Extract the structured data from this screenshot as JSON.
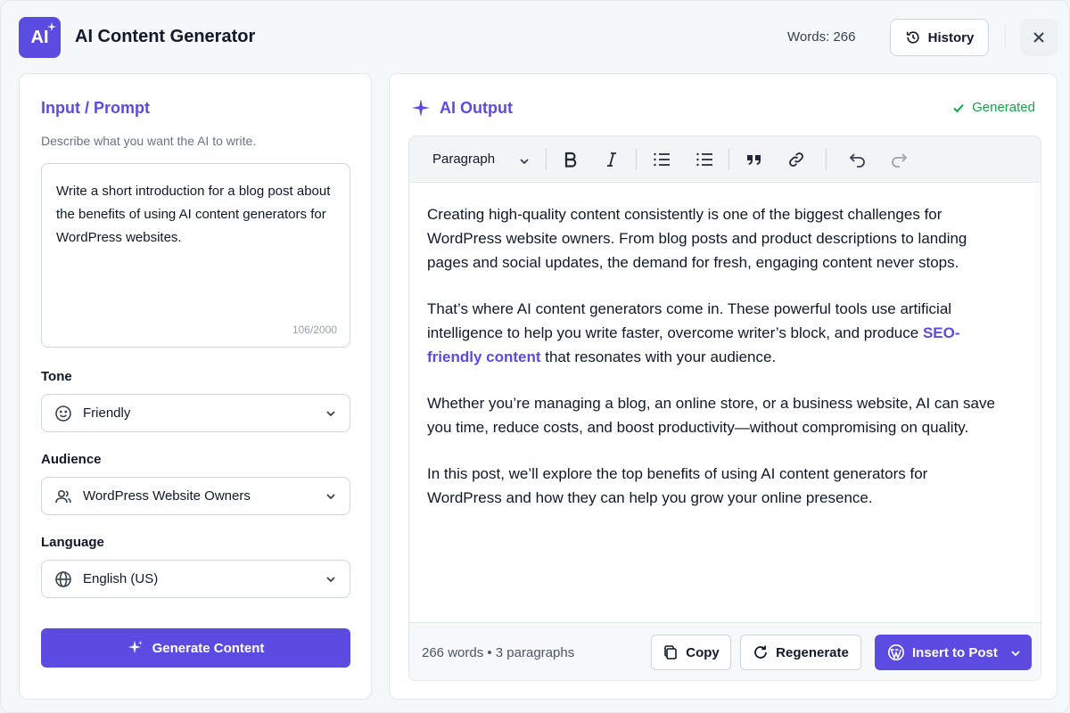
{
  "header": {
    "logo_text": "AI",
    "title": "AI Content Generator",
    "word_count": "Words: 266",
    "history_label": "History"
  },
  "input_panel": {
    "title": "Input / Prompt",
    "subtitle": "Describe what you want the AI to write.",
    "prompt_text": "Write a short introduction for a blog post about the benefits of using AI content generators for WordPress websites.",
    "char_count": "106/2000",
    "tone": {
      "label": "Tone",
      "value": "Friendly",
      "icon": "smiley-icon"
    },
    "audience": {
      "label": "Audience",
      "value": "WordPress Website Owners",
      "icon": "users-icon"
    },
    "language": {
      "label": "Language",
      "value": "English (US)",
      "icon": "globe-icon"
    },
    "generate_label": "Generate Content"
  },
  "output_panel": {
    "title": "AI Output",
    "status": "Generated",
    "toolbar": {
      "block_type": "Paragraph"
    },
    "paragraphs": {
      "p1": "Creating high-quality content consistently is one of the biggest challenges for WordPress website owners. From blog posts and product descriptions to landing pages and social updates, the demand for fresh, engaging content never stops.",
      "p2_before": "That’s where AI content generators come in. These powerful tools use artificial intelligence to help you write faster, overcome writer’s block, and produce ",
      "p2_link": "SEO-friendly content",
      "p2_after": " that resonates with your audience.",
      "p3": "Whether you’re managing a blog, an online store, or a business website, AI can save you time, reduce costs, and boost productivity—without compromising on quality.",
      "p4": "In this post, we’ll explore the top benefits of using AI content generators for WordPress and how they can help you grow your online presence."
    },
    "footer": {
      "stats": "266 words • 3 paragraphs",
      "copy_label": "Copy",
      "regenerate_label": "Regenerate",
      "insert_label": "Insert to Post"
    }
  },
  "colors": {
    "accent": "#5b4be0",
    "success": "#16a34a"
  }
}
